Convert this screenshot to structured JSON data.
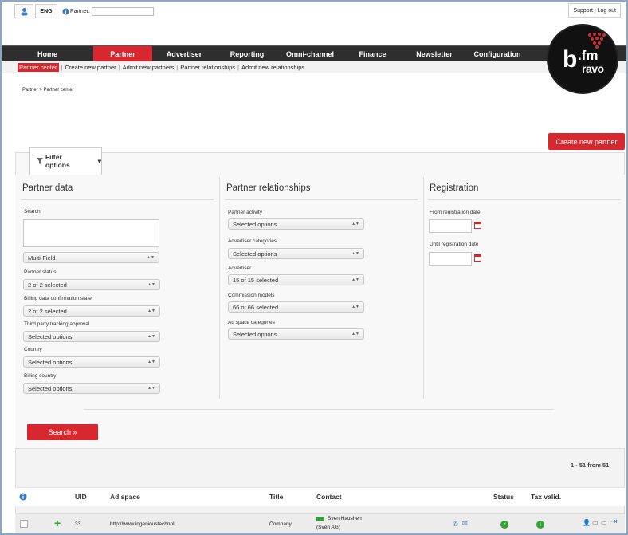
{
  "topbar": {
    "lang": "ENG",
    "partner_label": "Partner:",
    "partner_value": "",
    "support": "Support | Log out"
  },
  "nav": {
    "items": [
      "Home",
      "Partner",
      "Advertiser",
      "Reporting",
      "Omni-channel",
      "Finance",
      "Newsletter",
      "Configuration"
    ],
    "active": "Partner"
  },
  "subnav": [
    "Partner center",
    "Create new partner",
    "Admit new partners",
    "Partner relationships",
    "Admit new relationships"
  ],
  "logo": {
    "b": "b",
    "fm": ".fm",
    "ravo": "ravo"
  },
  "breadcrumb": "Partner  >  Partner center",
  "create_button": "Create new partner",
  "filter_tab": "Filter options",
  "partner_data": {
    "title": "Partner data",
    "search_label": "Search",
    "search_value": "",
    "multi_field": "Multi-Field",
    "partner_status_label": "Partner status",
    "partner_status": "2 of 2 selected",
    "billing_state_label": "Billing data confirmation state",
    "billing_state": "2 of 2 selected",
    "tracking_label": "Third party tracking approval",
    "tracking": "Selected options",
    "country_label": "Country",
    "country": "Selected options",
    "billing_country_label": "Billing country",
    "billing_country": "Selected options"
  },
  "relationships": {
    "title": "Partner relationships",
    "activity_label": "Partner activity",
    "activity": "Selected options",
    "adv_cat_label": "Advertiser categories",
    "adv_cat": "Selected options",
    "advertiser_label": "Advertiser",
    "advertiser": "15 of 15 selected",
    "commission_label": "Commission models",
    "commission": "66 of 66 selected",
    "adspace_cat_label": "Ad space categories",
    "adspace_cat": "Selected options"
  },
  "registration": {
    "title": "Registration",
    "from_label": "From registration date",
    "from_value": "",
    "until_label": "Until registration date",
    "until_value": ""
  },
  "search_button": "Search »",
  "results_count": "1 - 51 from 51",
  "table": {
    "headers": [
      "UID",
      "Ad space",
      "Title",
      "Contact",
      "Status",
      "Tax valid."
    ],
    "row": {
      "uid": "33",
      "ad_space": "http://www.ingenioustechnol...",
      "title": "Company",
      "contact_name": "Sven Hausherr",
      "contact_company": "(Sven AG)"
    }
  },
  "colors": {
    "accent": "#d7272f",
    "nav_bg": "#2e2e2e",
    "ok": "#2fa62f"
  }
}
